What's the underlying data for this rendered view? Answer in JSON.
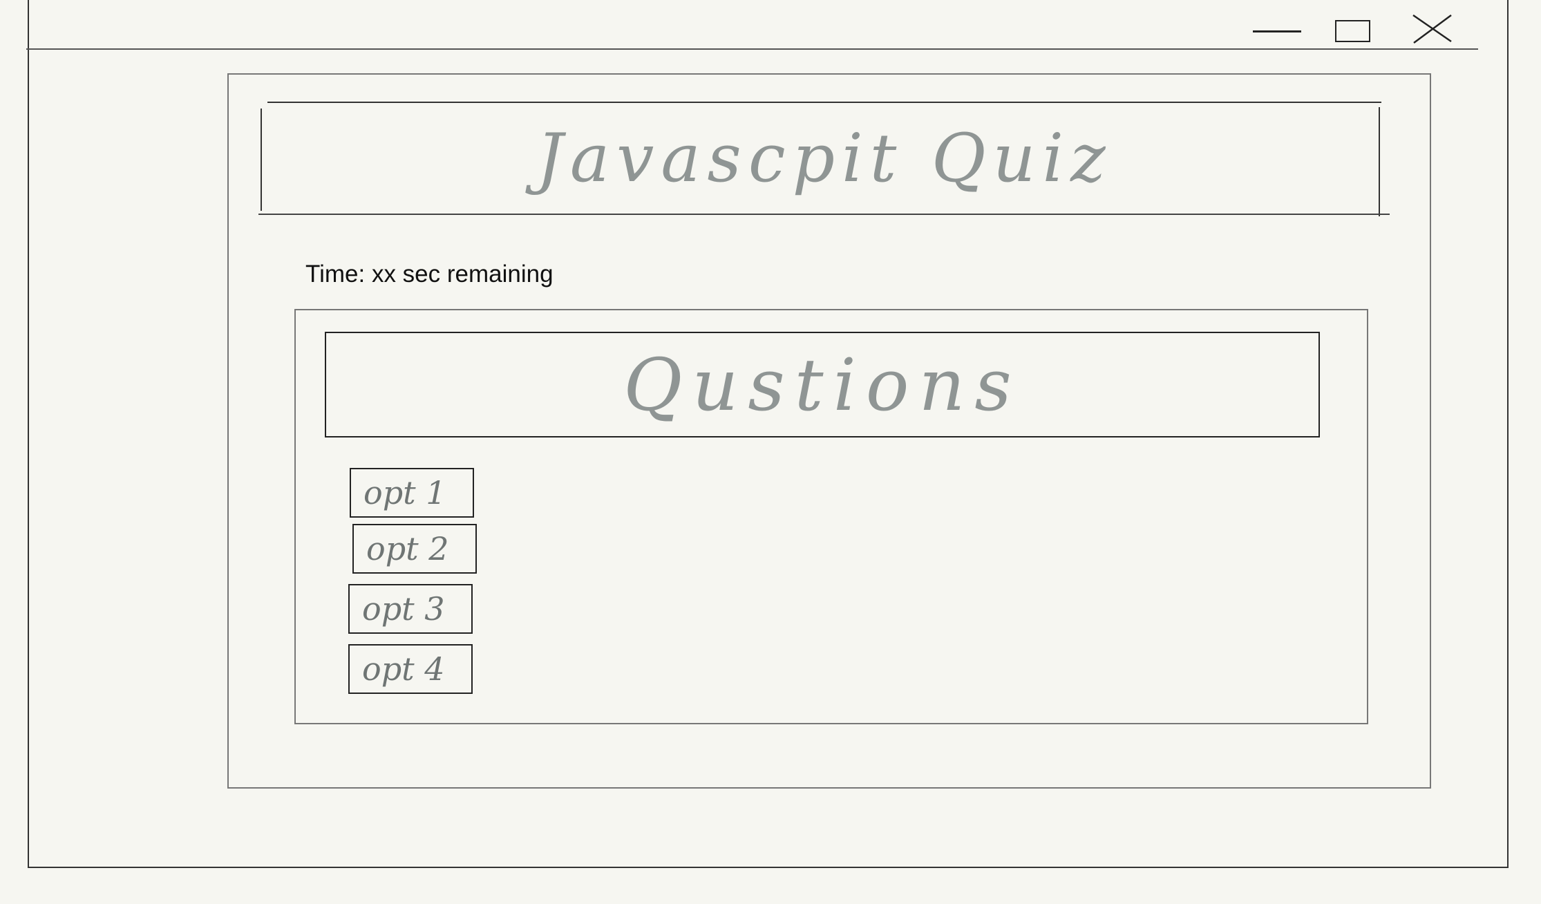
{
  "window": {
    "controls": {
      "minimize_icon": "minimize-icon",
      "maximize_icon": "maximize-icon",
      "close_icon": "close-icon"
    }
  },
  "app": {
    "title": "Javascpit Quiz",
    "timer": {
      "prefix": "Time: ",
      "value": "xx",
      "suffix": " sec remaining"
    }
  },
  "quiz": {
    "question": "Qustions",
    "options": [
      {
        "label": "opt 1"
      },
      {
        "label": "opt 2"
      },
      {
        "label": "opt 3"
      },
      {
        "label": "opt 4"
      }
    ]
  },
  "colors": {
    "background": "#f6f6f1",
    "sketch_ink": "#8f9594",
    "line": "#222222"
  }
}
